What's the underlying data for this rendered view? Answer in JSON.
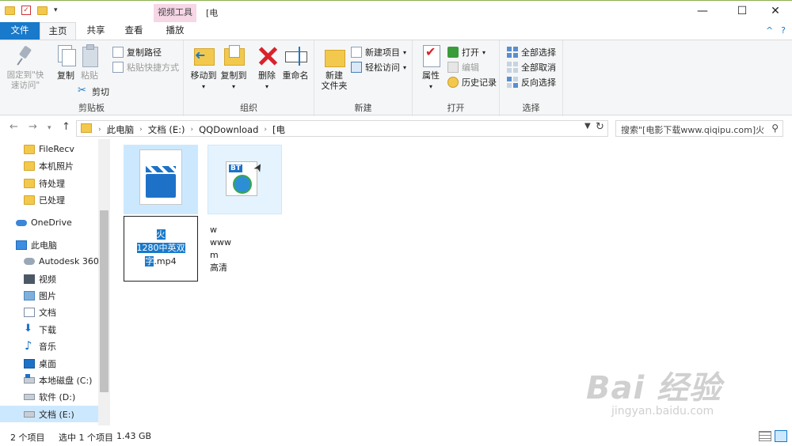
{
  "titlebar": {
    "context_tab_header": "视频工具",
    "window_title_fragment": "[电",
    "minimize": "—",
    "maximize": "☐",
    "close": "✕"
  },
  "tabs": {
    "file": "文件",
    "home": "主页",
    "share": "共享",
    "view": "查看",
    "play": "播放",
    "collapse": "^",
    "help": "?"
  },
  "ribbon": {
    "clipboard": {
      "label": "剪贴板",
      "pin": "固定到\"快速访问\"",
      "copy": "复制",
      "paste": "粘贴",
      "copy_path": "复制路径",
      "paste_shortcut": "粘贴快捷方式",
      "cut": "剪切"
    },
    "organize": {
      "label": "组织",
      "move_to": "移动到",
      "copy_to": "复制到",
      "delete": "删除",
      "rename": "重命名"
    },
    "new": {
      "label": "新建",
      "new_folder": "新建\n文件夹",
      "new_item": "新建项目",
      "easy_access": "轻松访问"
    },
    "open": {
      "label": "打开",
      "properties": "属性",
      "open": "打开",
      "edit": "编辑",
      "history": "历史记录"
    },
    "select": {
      "label": "选择",
      "select_all": "全部选择",
      "select_none": "全部取消",
      "invert": "反向选择"
    }
  },
  "address": {
    "crumbs": [
      "此电脑",
      "文档 (E:)",
      "QQDownload",
      "[电"
    ],
    "search_placeholder": "搜索\"[电影下载www.qiqipu.com]火..."
  },
  "navpane": {
    "items": [
      {
        "label": "FileRecv",
        "icon": "folder-icon"
      },
      {
        "label": "本机照片",
        "icon": "folder-icon"
      },
      {
        "label": "待处理",
        "icon": "folder-icon"
      },
      {
        "label": "已处理",
        "icon": "folder-icon"
      },
      {
        "label": "OneDrive",
        "icon": "onedrive-icon"
      },
      {
        "label": "此电脑",
        "icon": "computer-icon"
      },
      {
        "label": "Autodesk 360",
        "icon": "autodesk-icon"
      },
      {
        "label": "视频",
        "icon": "videos-icon"
      },
      {
        "label": "图片",
        "icon": "pictures-icon"
      },
      {
        "label": "文档",
        "icon": "documents-icon"
      },
      {
        "label": "下载",
        "icon": "downloads-icon"
      },
      {
        "label": "音乐",
        "icon": "music-icon"
      },
      {
        "label": "桌面",
        "icon": "desktop-icon"
      },
      {
        "label": "本地磁盘 (C:)",
        "icon": "drive-c-icon"
      },
      {
        "label": "软件 (D:)",
        "icon": "drive-d-icon"
      },
      {
        "label": "文档 (E:)",
        "icon": "drive-e-icon"
      }
    ]
  },
  "files": [
    {
      "name_line1": "火",
      "name_line2": "1280中英双",
      "name_line3": "字",
      "name_tail": ".mp4",
      "type": "video"
    },
    {
      "name_line1": "w",
      "name_line2": "www",
      "name_line3": "m",
      "name_line4": "高清",
      "type": "torrent"
    }
  ],
  "status": {
    "count": "2 个项目",
    "selected": "选中 1 个项目",
    "size": "1.43 GB"
  },
  "watermark": {
    "main": "Bai 经验",
    "sub": "jingyan.baidu.com"
  }
}
